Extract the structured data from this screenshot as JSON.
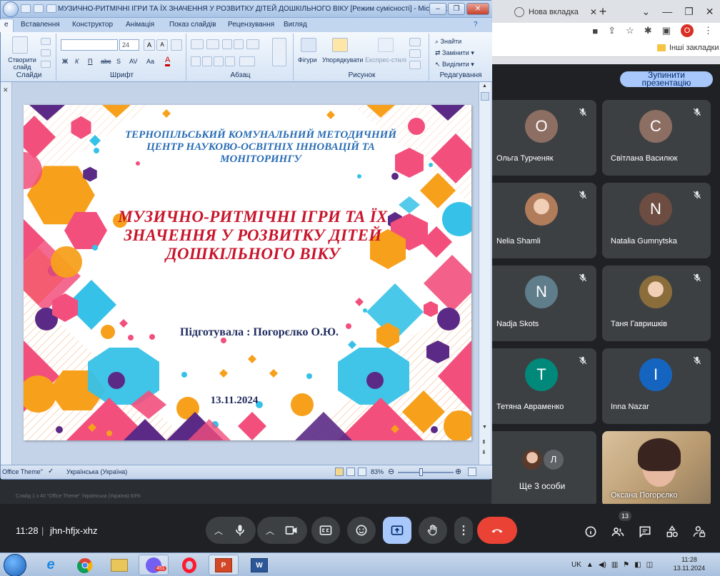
{
  "browser": {
    "tab_title": "Нова вкладка",
    "bookmarks_label": "Інші закладки",
    "profile_initial": "O"
  },
  "meet": {
    "stop_presenting": "Зупинити презентацію",
    "participants": [
      {
        "name": "Ольга Турченяк",
        "initial": "О",
        "color": "#8d6e63"
      },
      {
        "name": "Світлана Василюк",
        "initial": "С",
        "color": "#8d6e63"
      },
      {
        "name": "Nelia Shamli",
        "initial": "",
        "color": "#b07c5a"
      },
      {
        "name": "Natalia Gumnytska",
        "initial": "N",
        "color": "#6d4c41"
      },
      {
        "name": "Nadja Skots",
        "initial": "N",
        "color": "#607d8b"
      },
      {
        "name": "Таня Гавришків",
        "initial": "",
        "color": "#8a6d3b"
      },
      {
        "name": "Тетяна Авраменко",
        "initial": "T",
        "color": "#00897b"
      },
      {
        "name": "Inna Nazar",
        "initial": "I",
        "color": "#1565c0"
      },
      {
        "name": "Ще 3 особи",
        "initial": "Л",
        "color": "#5f6368"
      },
      {
        "name": "Оксана Погорєлко",
        "initial": "",
        "color": "#c8a985"
      }
    ],
    "time": "11:28",
    "separator": "|",
    "meeting_code": "jhn-hfjx-xhz",
    "participant_count": "13"
  },
  "ppt": {
    "window_title": "МУЗИЧНО-РИТМІЧНІ ІГРИ ТА ЇХ ЗНАЧЕННЯ У РОЗВИТКУ ДІТЕЙ ДОШКІЛЬНОГО ВІКУ [Режим сумісності] - Microsoft...",
    "ribbon_tabs": [
      "е",
      "Вставлення",
      "Конструктор",
      "Анімація",
      "Показ слайдів",
      "Рецензування",
      "Вигляд"
    ],
    "groups": {
      "slides": "Слайди",
      "font": "Шрифт",
      "paragraph": "Абзац",
      "drawing": "Рисунок",
      "editing": "Редагування"
    },
    "create_slide": "Створити слайд",
    "font_size": "24",
    "font_buttons": [
      "Ж",
      "К",
      "П",
      "abc",
      "S",
      "AV",
      "Aa"
    ],
    "shapes": "Фігури",
    "arrange": "Упорядкувати",
    "express_styles": "Експрес-стилі",
    "find": "Знайти",
    "replace": "Замінити",
    "select": "Виділити",
    "slide": {
      "org": "ТЕРНОПІЛЬСЬКИЙ КОМУНАЛЬНИЙ МЕТОДИЧНИЙ ЦЕНТР НАУКОВО-ОСВІТНІХ  ІННОВАЦІЙ  ТА МОНІТОРИНГУ",
      "title": "МУЗИЧНО-РИТМІЧНІ ІГРИ ТА ЇХ ЗНАЧЕННЯ У РОЗВИТКУ ДІТЕЙ ДОШКІЛЬНОГО ВІКУ",
      "author": "Підготувала : Погорєлко О.Ю.",
      "date": "13.11.2024"
    },
    "status": {
      "theme": "Office Theme\"",
      "language": "Українська (Україна)",
      "zoom": "83%"
    }
  },
  "ghost_status": "Слайд 1 з 40     \"Office Theme\"      Українська (Україна)                                                                  83%",
  "taskbar": {
    "viber_badge": "451",
    "lang": "UK",
    "clock_time": "11:28",
    "clock_date": "13.11.2024"
  }
}
